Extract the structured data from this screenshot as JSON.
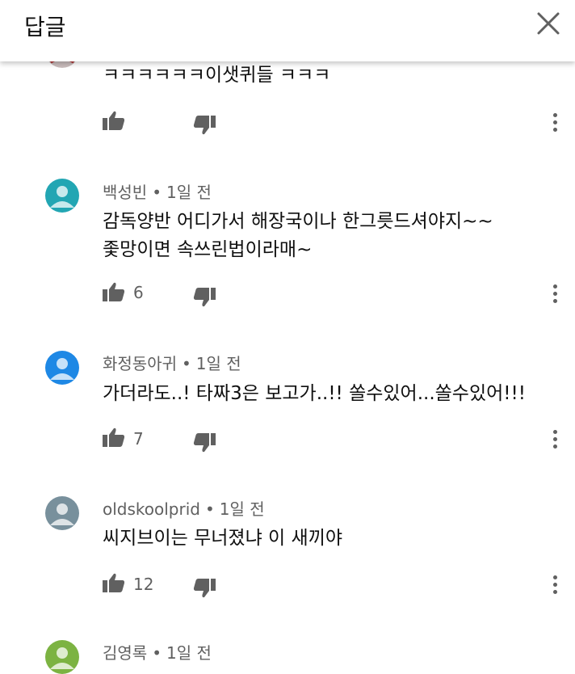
{
  "header": {
    "title": "답글"
  },
  "icons": {
    "close": "close-icon",
    "like": "thumbs-up-icon",
    "dislike": "thumbs-down-icon",
    "more": "more-vert-icon"
  },
  "colors": {
    "meta": "#606060",
    "text": "#0f0f0f"
  },
  "comments": [
    {
      "author": "",
      "time": "",
      "lines": [
        "ㅋㅋㅋㅋㅋㅋ이샛퀴들 ㅋㅋㅋ"
      ],
      "likes": "",
      "avatar_color": "#b23a3a"
    },
    {
      "author": "백성빈",
      "time": "1일 전",
      "lines": [
        "감독양반 어디가서 해장국이나 한그릇드셔야지~~",
        "좇망이면 속쓰린법이라매~"
      ],
      "likes": "6",
      "avatar_color": "#22a6b3"
    },
    {
      "author": "화정동아귀",
      "time": "1일 전",
      "lines": [
        "가더라도..! 타짜3은 보고가..!!  쏠수있어...쏠수있어!!!"
      ],
      "likes": "7",
      "avatar_color": "#1e88e5"
    },
    {
      "author": "oldskoolprid",
      "time": "1일 전",
      "lines": [
        "씨지브이는 무너졌냐 이 새끼야"
      ],
      "likes": "12",
      "avatar_color": "#78909c"
    },
    {
      "author": "김영록",
      "time": "1일 전",
      "lines": [],
      "likes": "",
      "avatar_color": "#7cb342"
    }
  ]
}
